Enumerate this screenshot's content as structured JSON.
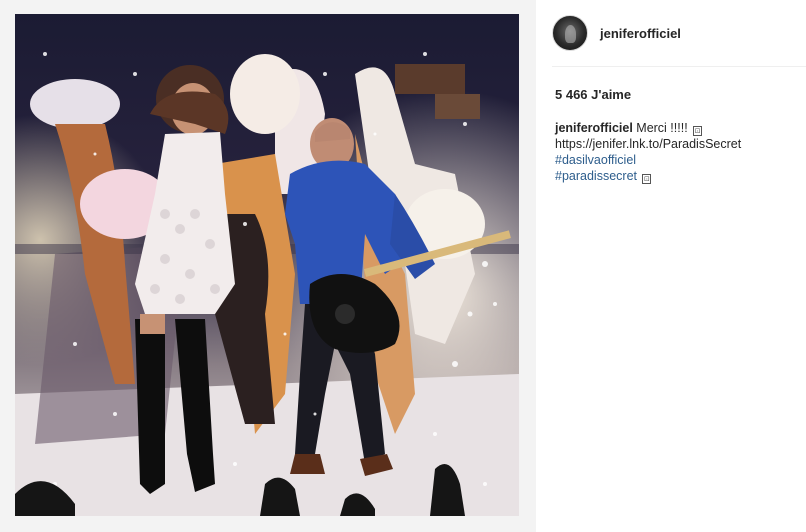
{
  "post": {
    "author": {
      "username": "jeniferofficiel",
      "avatar_icon": "profile-avatar"
    },
    "likes_text": "5 466 J'aime",
    "caption": {
      "author": "jeniferofficiel",
      "text": "Merci !!!!!",
      "emoji_1": "⊡",
      "link": "https://jenifer.lnk.to/ParadisSecret",
      "hashtags": [
        "#dasilvaofficiel",
        "#paradissecret"
      ],
      "emoji_2": "⊡"
    },
    "photo": {
      "description_icon": "stage-performance-photo"
    }
  },
  "colors": {
    "text": "#262626",
    "hashtag": "#2d5d8c",
    "divider": "#efefef"
  }
}
